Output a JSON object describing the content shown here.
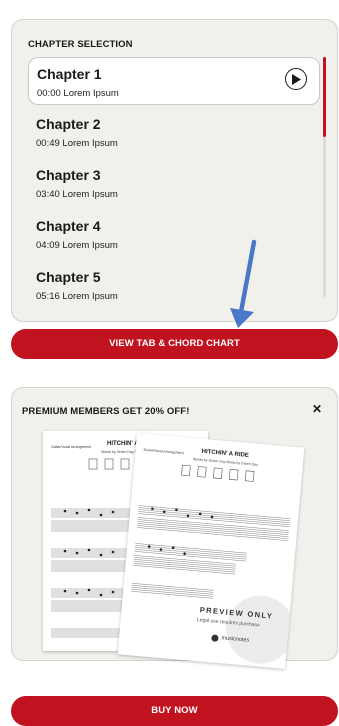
{
  "chapters_panel": {
    "title": "CHAPTER SELECTION",
    "items": [
      {
        "name": "Chapter 1",
        "time": "00:00",
        "desc": "Lorem Ipsum",
        "active": true
      },
      {
        "name": "Chapter 2",
        "time": "00:49",
        "desc": "Lorem Ipsum",
        "active": false
      },
      {
        "name": "Chapter 3",
        "time": "03:40",
        "desc": "Lorem Ipsum",
        "active": false
      },
      {
        "name": "Chapter 4",
        "time": "04:09",
        "desc": "Lorem Ipsum",
        "active": false
      },
      {
        "name": "Chapter 5",
        "time": "05:16",
        "desc": "Lorem Ipsum",
        "active": false
      }
    ],
    "items_meta": [
      "00:00 Lorem Ipsum",
      "00:49 Lorem Ipsum",
      "03:40 Lorem Ipsum",
      "04:09 Lorem Ipsum",
      "05:16 Lorem Ipsum"
    ],
    "play_icon": "play-circle-icon",
    "scroll_position": 0.0
  },
  "view_button": {
    "label": "VIEW TAB & CHORD CHART"
  },
  "annotation": {
    "icon": "blue-arrow-pointing-down",
    "color": "#4a78c8"
  },
  "promo": {
    "title": "PREMIUM MEMBERS GET 20% OFF!",
    "close_icon": "close-x-icon",
    "sheet_back": {
      "arrangement": "Guitar/Vocal Arrangement",
      "title": "HITCHIN' A RIDE",
      "subtitle": "Words by Green Day  Music by Green Day"
    },
    "sheet_front": {
      "arrangement": "Guitar/Vocal Arrangement",
      "title": "HITCHIN' A RIDE",
      "subtitle": "Words by Green Day  Music by Green Day",
      "watermark": "PREVIEW ONLY",
      "watermark_sub": "Legal use requires purchase",
      "brand": "musicnotes"
    }
  },
  "buy_button": {
    "label": "BUY NOW"
  },
  "colors": {
    "accent": "#c1121f",
    "panel_bg": "#f1f0ec",
    "panel_border": "#d4d3cd"
  }
}
